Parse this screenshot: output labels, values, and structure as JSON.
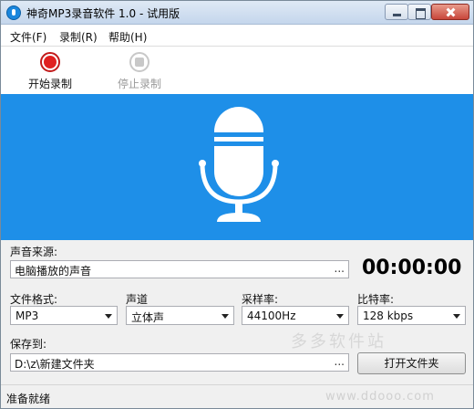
{
  "window": {
    "title": "神奇MP3录音软件 1.0 - 试用版",
    "icon": "app-record-icon"
  },
  "menu": {
    "file": "文件(F)",
    "record": "录制(R)",
    "help": "帮助(H)"
  },
  "toolbar": {
    "start_label": "开始录制",
    "stop_label": "停止录制",
    "start_icon": "record-icon",
    "stop_icon": "stop-icon"
  },
  "banner": {
    "icon": "microphone-icon",
    "color": "#1e8fe8"
  },
  "form": {
    "source_label": "声音来源:",
    "source_value": "电脑播放的声音",
    "browse_dots": "...",
    "timer": "00:00:00",
    "format_label": "文件格式:",
    "format_value": "MP3",
    "channel_label": "声道",
    "channel_value": "立体声",
    "samplerate_label": "采样率:",
    "samplerate_value": "44100Hz",
    "bitrate_label": "比特率:",
    "bitrate_value": "128 kbps",
    "save_label": "保存到:",
    "save_path": "D:\\z\\新建文件夹",
    "open_folder_label": "打开文件夹"
  },
  "watermark": {
    "text": "多多软件站",
    "url": "www.ddooo.com"
  },
  "status": {
    "text": "准备就绪"
  }
}
